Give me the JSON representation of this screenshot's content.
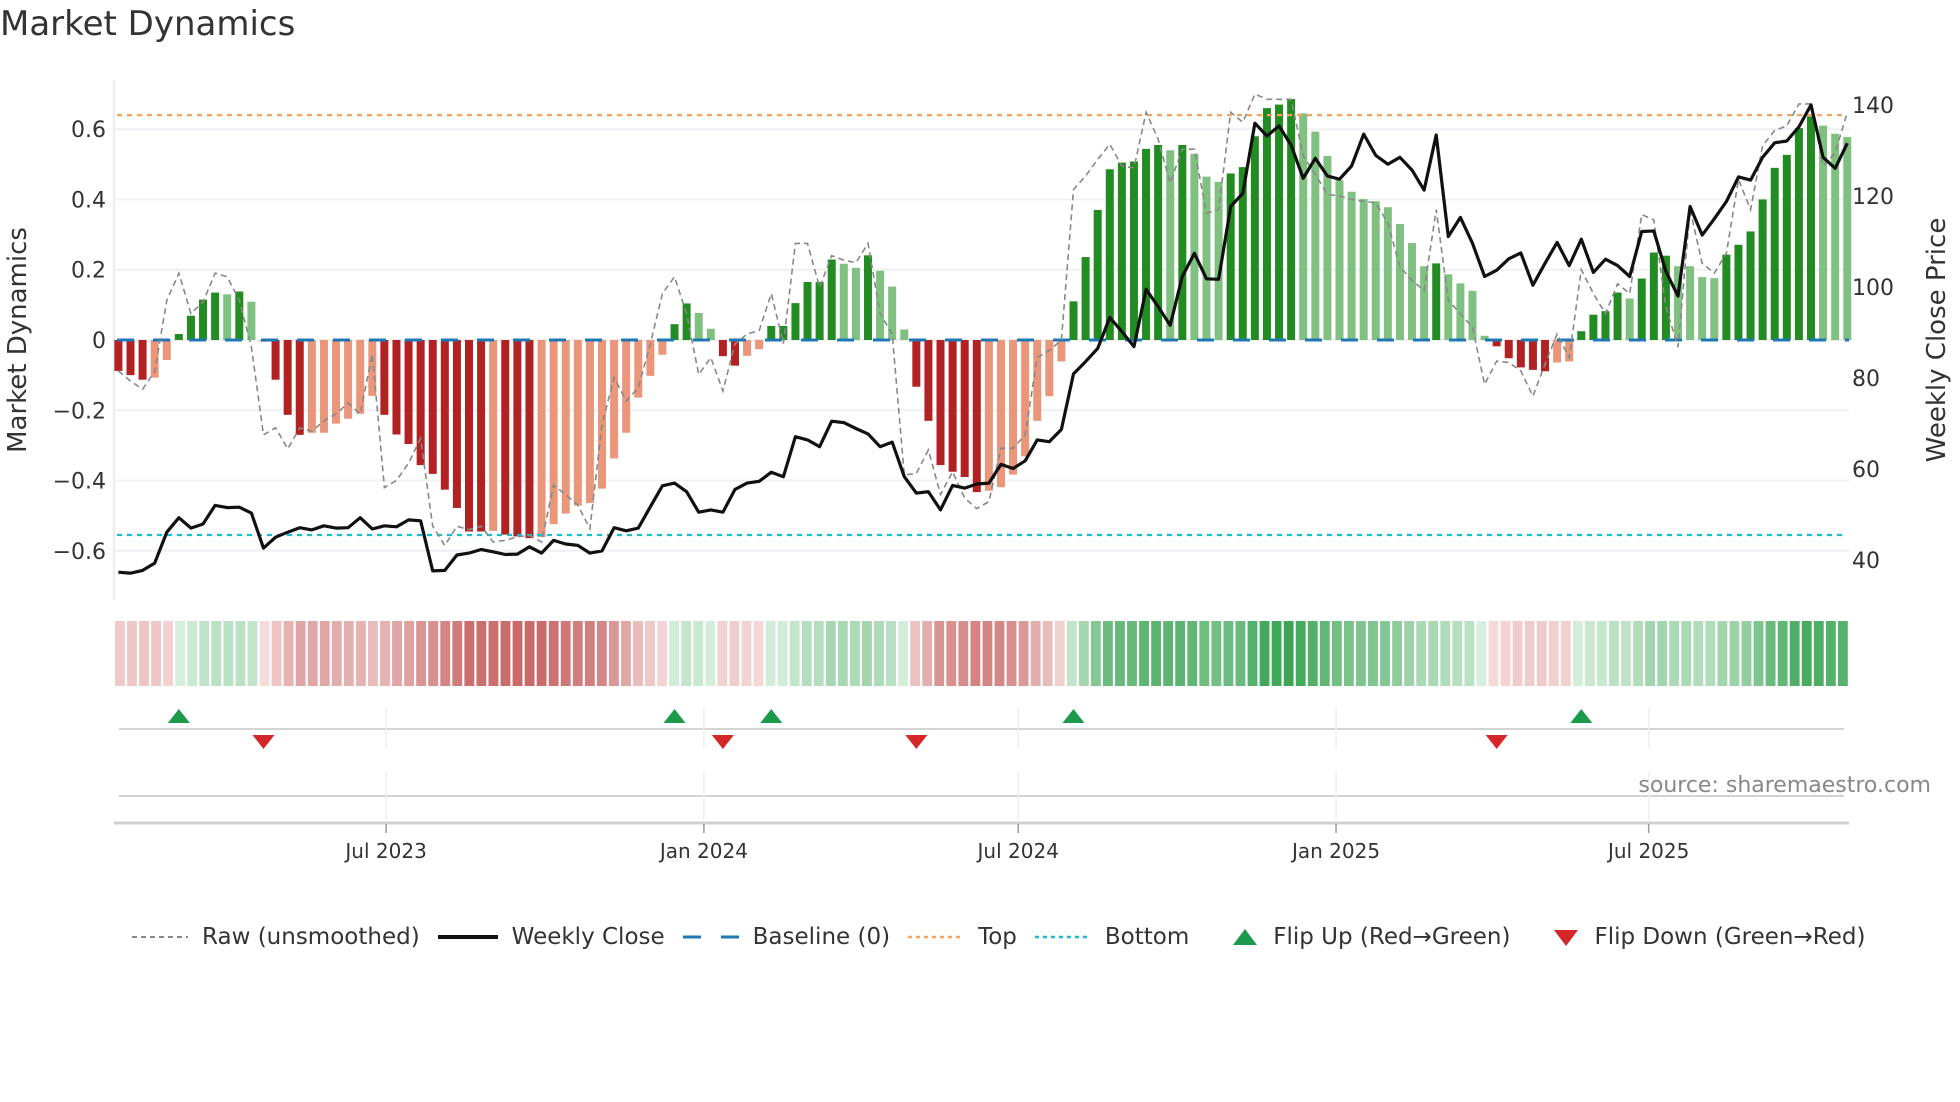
{
  "title": "Market Dynamics",
  "source": "source: sharemaestro.com",
  "legend": [
    {
      "label": "Raw (unsmoothed)",
      "icon": "dashed-gray-line"
    },
    {
      "label": "Weekly Close",
      "icon": "solid-black-line"
    },
    {
      "label": "Baseline (0)",
      "icon": "dashed-blue-line"
    },
    {
      "label": "Top",
      "icon": "dotted-orange-line"
    },
    {
      "label": "Bottom",
      "icon": "dotted-cyan-line"
    },
    {
      "label": "Flip Up (Red→Green)",
      "icon": "green-up-triangle"
    },
    {
      "label": "Flip Down (Green→Red)",
      "icon": "red-down-triangle"
    }
  ],
  "colors": {
    "D": "#228b22",
    "L": "#80c080",
    "R": "#b22222",
    "P": "#e9967a",
    "raw": "#888888",
    "close": "#111111",
    "baseline": "#1f77b4",
    "top": "#f4a460",
    "bottom": "#17becf",
    "flip_up": "#1a9a4a",
    "flip_down": "#d62728"
  },
  "chart_data": {
    "type": "bar",
    "title": "Market Dynamics",
    "ylabel": "Market Dynamics",
    "y2label": "Weekly Close Price",
    "ylim": [
      -0.74,
      0.74
    ],
    "y2lim": [
      31.2,
      145.5
    ],
    "yticks": [
      {
        "v": 0.6,
        "label": "0.6"
      },
      {
        "v": 0.4,
        "label": "0.4"
      },
      {
        "v": 0.2,
        "label": "0.2"
      },
      {
        "v": 0,
        "label": "0"
      },
      {
        "v": -0.2,
        "label": "−0.2"
      },
      {
        "v": -0.4,
        "label": "−0.4"
      },
      {
        "v": -0.6,
        "label": "−0.6"
      }
    ],
    "y2ticks": [
      {
        "v": 140,
        "label": "140"
      },
      {
        "v": 120,
        "label": "120"
      },
      {
        "v": 100,
        "label": "100"
      },
      {
        "v": 80,
        "label": "80"
      },
      {
        "v": 60,
        "label": "60"
      },
      {
        "v": 40,
        "label": "40"
      }
    ],
    "xticks": [
      {
        "date": "2023-07-01",
        "label": "Jul 2023"
      },
      {
        "date": "2024-01-01",
        "label": "Jan 2024"
      },
      {
        "date": "2024-07-01",
        "label": "Jul 2024"
      },
      {
        "date": "2025-01-01",
        "label": "Jan 2025"
      },
      {
        "date": "2025-07-01",
        "label": "Jul 2025"
      }
    ],
    "start_date": "2023-01-27",
    "interval": "weekly",
    "top_level": 0.64,
    "bottom_level": -0.555,
    "baseline": 0,
    "smoothed": [
      -0.088,
      -0.1,
      -0.113,
      -0.107,
      -0.057,
      0.017,
      0.069,
      0.115,
      0.135,
      0.13,
      0.138,
      0.109,
      -0.005,
      -0.113,
      -0.213,
      -0.27,
      -0.264,
      -0.264,
      -0.238,
      -0.224,
      -0.21,
      -0.159,
      -0.213,
      -0.269,
      -0.296,
      -0.356,
      -0.381,
      -0.426,
      -0.478,
      -0.545,
      -0.545,
      -0.543,
      -0.554,
      -0.559,
      -0.564,
      -0.561,
      -0.524,
      -0.494,
      -0.471,
      -0.464,
      -0.423,
      -0.337,
      -0.264,
      -0.164,
      -0.102,
      -0.042,
      0.045,
      0.104,
      0.077,
      0.032,
      -0.046,
      -0.073,
      -0.045,
      -0.026,
      0.04,
      0.04,
      0.105,
      0.165,
      0.165,
      0.229,
      0.217,
      0.205,
      0.241,
      0.197,
      0.152,
      0.03,
      -0.133,
      -0.23,
      -0.356,
      -0.375,
      -0.39,
      -0.433,
      -0.429,
      -0.419,
      -0.383,
      -0.331,
      -0.23,
      -0.16,
      -0.061,
      0.11,
      0.236,
      0.37,
      0.486,
      0.505,
      0.508,
      0.544,
      0.555,
      0.54,
      0.555,
      0.53,
      0.465,
      0.45,
      0.474,
      0.492,
      0.58,
      0.66,
      0.67,
      0.686,
      0.645,
      0.593,
      0.524,
      0.455,
      0.422,
      0.401,
      0.395,
      0.378,
      0.33,
      0.276,
      0.21,
      0.218,
      0.187,
      0.161,
      0.14,
      0.012,
      -0.018,
      -0.052,
      -0.078,
      -0.085,
      -0.089,
      -0.064,
      -0.061,
      0.025,
      0.072,
      0.082,
      0.135,
      0.118,
      0.175,
      0.249,
      0.24,
      0.21,
      0.21,
      0.179,
      0.176,
      0.243,
      0.271,
      0.309,
      0.4,
      0.49,
      0.527,
      0.603,
      0.636,
      0.61,
      0.587,
      0.578
    ],
    "states": [
      "R",
      "R",
      "R",
      "P",
      "P",
      "D",
      "D",
      "D",
      "D",
      "L",
      "D",
      "L",
      "P",
      "R",
      "R",
      "R",
      "P",
      "P",
      "P",
      "P",
      "P",
      "P",
      "R",
      "R",
      "R",
      "R",
      "R",
      "R",
      "R",
      "R",
      "R",
      "P",
      "R",
      "R",
      "R",
      "P",
      "P",
      "P",
      "P",
      "P",
      "P",
      "P",
      "P",
      "P",
      "P",
      "P",
      "D",
      "D",
      "L",
      "L",
      "R",
      "R",
      "P",
      "P",
      "D",
      "D",
      "D",
      "D",
      "D",
      "D",
      "L",
      "L",
      "D",
      "L",
      "L",
      "L",
      "R",
      "R",
      "R",
      "R",
      "R",
      "R",
      "P",
      "P",
      "P",
      "P",
      "P",
      "P",
      "P",
      "D",
      "D",
      "D",
      "D",
      "D",
      "D",
      "D",
      "D",
      "L",
      "D",
      "L",
      "L",
      "L",
      "D",
      "D",
      "D",
      "D",
      "D",
      "D",
      "L",
      "L",
      "L",
      "L",
      "L",
      "L",
      "L",
      "L",
      "L",
      "L",
      "L",
      "D",
      "L",
      "L",
      "L",
      "L",
      "R",
      "R",
      "R",
      "R",
      "R",
      "P",
      "P",
      "D",
      "D",
      "D",
      "D",
      "L",
      "D",
      "D",
      "D",
      "L",
      "L",
      "L",
      "L",
      "D",
      "D",
      "D",
      "D",
      "D",
      "D",
      "D",
      "D",
      "L",
      "L",
      "L"
    ],
    "raw": [
      -0.088,
      -0.117,
      -0.14,
      -0.09,
      0.113,
      0.19,
      0.075,
      0.108,
      0.19,
      0.18,
      0.113,
      -0.02,
      -0.27,
      -0.25,
      -0.31,
      -0.25,
      -0.26,
      -0.23,
      -0.21,
      -0.18,
      -0.21,
      -0.04,
      -0.42,
      -0.4,
      -0.35,
      -0.28,
      -0.53,
      -0.585,
      -0.53,
      -0.54,
      -0.53,
      -0.575,
      -0.57,
      -0.56,
      -0.556,
      -0.575,
      -0.413,
      -0.44,
      -0.47,
      -0.537,
      -0.24,
      -0.107,
      -0.174,
      -0.136,
      -0.01,
      0.132,
      0.18,
      0.075,
      -0.098,
      -0.05,
      -0.145,
      -0.011,
      0.017,
      0.027,
      0.132,
      -0.01,
      0.275,
      0.275,
      0.15,
      0.24,
      0.227,
      0.22,
      0.275,
      0.075,
      0.017,
      -0.384,
      -0.38,
      -0.313,
      -0.44,
      -0.375,
      -0.45,
      -0.48,
      -0.46,
      -0.308,
      -0.308,
      -0.27,
      -0.05,
      -0.03,
      0.0,
      0.428,
      0.467,
      0.514,
      0.557,
      0.495,
      0.49,
      0.648,
      0.572,
      0.447,
      0.543,
      0.543,
      0.361,
      0.371,
      0.648,
      0.62,
      0.7,
      0.685,
      0.685,
      0.685,
      0.524,
      0.471,
      0.414,
      0.41,
      0.4,
      0.395,
      0.39,
      0.333,
      0.208,
      0.17,
      0.141,
      0.371,
      0.113,
      0.075,
      0.036,
      -0.126,
      -0.06,
      -0.064,
      -0.088,
      -0.16,
      -0.069,
      0.017,
      -0.05,
      0.2,
      0.132,
      0.075,
      0.16,
      0.132,
      0.357,
      0.342,
      0.094,
      -0.02,
      0.371,
      0.218,
      0.19,
      0.247,
      0.457,
      0.371,
      0.553,
      0.596,
      0.61,
      0.672,
      0.672,
      0.495,
      0.533,
      0.648
    ],
    "weekly_close": [
      37.3,
      37.1,
      37.7,
      39.3,
      46.1,
      49.3,
      47.0,
      47.9,
      52.0,
      51.5,
      51.6,
      50.3,
      42.6,
      45.0,
      46.1,
      47.1,
      46.6,
      47.5,
      47.0,
      47.1,
      49.3,
      46.8,
      47.5,
      47.3,
      48.8,
      48.6,
      37.6,
      37.7,
      41.1,
      41.5,
      42.3,
      41.8,
      41.2,
      41.3,
      42.9,
      41.5,
      44.3,
      43.5,
      43.2,
      41.5,
      42.0,
      47.1,
      46.4,
      47.0,
      51.7,
      56.3,
      56.9,
      55.0,
      50.5,
      51.0,
      50.5,
      55.5,
      56.9,
      57.3,
      59.3,
      58.3,
      67.1,
      66.4,
      64.9,
      70.5,
      70.2,
      68.9,
      67.7,
      64.9,
      65.9,
      58.3,
      54.7,
      55.0,
      51.0,
      56.4,
      55.8,
      56.7,
      56.9,
      61.0,
      60.1,
      61.8,
      66.4,
      66.0,
      68.7,
      80.9,
      83.6,
      86.5,
      93.3,
      90.2,
      86.9,
      99.5,
      95.7,
      91.6,
      102.3,
      107.4,
      101.8,
      101.7,
      117.7,
      120.6,
      136.0,
      133.2,
      135.4,
      131.2,
      123.9,
      128.3,
      124.4,
      123.7,
      126.6,
      133.6,
      128.9,
      127.0,
      128.5,
      125.7,
      121.3,
      133.4,
      111.1,
      115.3,
      109.6,
      102.3,
      103.7,
      106.2,
      107.5,
      100.4,
      105.2,
      109.8,
      104.7,
      110.5,
      103.2,
      106.1,
      104.7,
      102.3,
      112.2,
      112.3,
      103.4,
      98.0,
      117.7,
      111.4,
      115.0,
      118.8,
      124.2,
      123.5,
      128.5,
      131.7,
      132.1,
      135.2,
      140.0,
      128.5,
      126.1,
      131.6
    ],
    "flip_up_weeks": [
      6,
      47,
      55,
      80,
      122
    ],
    "flip_down_weeks": [
      13,
      51,
      67,
      115
    ]
  }
}
